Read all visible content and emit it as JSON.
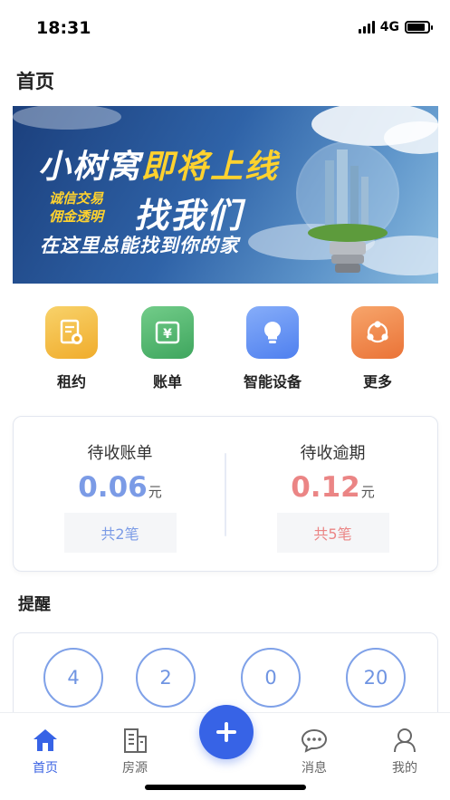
{
  "status": {
    "time": "18:31",
    "network": "4G",
    "battery_level": 0.85
  },
  "page": {
    "title": "首页"
  },
  "banner": {
    "line1_white": "小树窝",
    "line1_yellow": "即将上线",
    "sub1": "诚信交易",
    "sub2": "佣金透明",
    "find": "找我们",
    "line3": "在这里总能找到你的家"
  },
  "quick_actions": [
    {
      "label": "租约",
      "icon": "lease-icon",
      "color": "#f3b73a"
    },
    {
      "label": "账单",
      "icon": "bill-icon",
      "color": "#4fb36d"
    },
    {
      "label": "智能设备",
      "icon": "smart-device-icon",
      "color": "#5b8ef5"
    },
    {
      "label": "更多",
      "icon": "more-icon",
      "color": "#f08a45"
    }
  ],
  "bills": {
    "pending": {
      "title": "待收账单",
      "amount": "0.06",
      "unit": "元",
      "count": "共2笔",
      "color": "#7b9be6"
    },
    "overdue": {
      "title": "待收逾期",
      "amount": "0.12",
      "unit": "元",
      "count": "共5笔",
      "color": "#eb8585"
    }
  },
  "reminders": {
    "title": "提醒",
    "values": [
      "4",
      "2",
      "0",
      "20"
    ]
  },
  "tabbar": {
    "items": [
      {
        "label": "首页",
        "icon": "home-icon",
        "active": true
      },
      {
        "label": "房源",
        "icon": "building-icon",
        "active": false
      },
      {
        "label": "消息",
        "icon": "message-icon",
        "active": false
      },
      {
        "label": "我的",
        "icon": "profile-icon",
        "active": false
      }
    ],
    "add": "plus-icon"
  },
  "colors": {
    "accent": "#3763e6",
    "pending": "#7b9be6",
    "overdue": "#eb8585"
  }
}
